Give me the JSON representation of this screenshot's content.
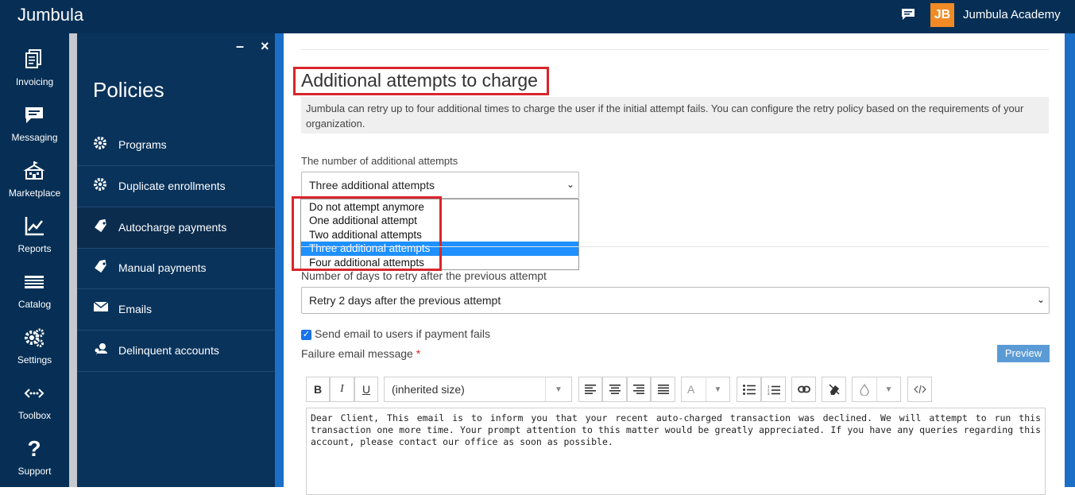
{
  "app": {
    "brand": "Jumbula",
    "org_name": "Jumbula Academy",
    "logo_text": "JB",
    "colors": {
      "nav_bg": "#072f55",
      "panel_bg": "#09335b",
      "accent": "#1b6fc6",
      "highlight": "#d9262b",
      "logo": "#f08a24"
    }
  },
  "leftnav": [
    {
      "label": "Invoicing",
      "icon": "invoice-icon"
    },
    {
      "label": "Messaging",
      "icon": "message-icon"
    },
    {
      "label": "Marketplace",
      "icon": "marketplace-icon"
    },
    {
      "label": "Reports",
      "icon": "chart-icon"
    },
    {
      "label": "Catalog",
      "icon": "catalog-icon"
    },
    {
      "label": "Settings",
      "icon": "gear-icon"
    },
    {
      "label": "Toolbox",
      "icon": "toolbox-icon"
    },
    {
      "label": "Support",
      "icon": "question-icon"
    }
  ],
  "panel": {
    "minimize": "–",
    "close": "×",
    "title": "Policies",
    "items": [
      {
        "label": "Programs",
        "icon": "gear-icon"
      },
      {
        "label": "Duplicate enrollments",
        "icon": "gear-icon"
      },
      {
        "label": "Autocharge payments",
        "icon": "tag-icon",
        "active": true
      },
      {
        "label": "Manual payments",
        "icon": "tag-icon"
      },
      {
        "label": "Emails",
        "icon": "envelope-icon"
      },
      {
        "label": "Delinquent accounts",
        "icon": "user-key-icon"
      }
    ]
  },
  "main": {
    "heading": "Additional attempts to charge",
    "info": "Jumbula can retry up to four additional times to charge the user if the initial attempt fails. You can configure the retry policy based on the requirements of your organization.",
    "attempts_label": "The number of additional attempts",
    "attempts_value": "Three additional attempts",
    "attempts_options": [
      "Do not attempt anymore",
      "One additional attempt",
      "Two additional attempts",
      "Three additional attempts",
      "Four additional attempts"
    ],
    "retry_label": "Number of days to retry after the previous attempt",
    "retry_value": "Retry 2 days after the previous attempt",
    "email_checkbox_label": "Send email to users if payment fails",
    "email_checked": true,
    "failure_label": "Failure email message",
    "required_mark": "*",
    "preview_label": "Preview",
    "editor": {
      "bold": "B",
      "italic": "I",
      "underline": "U",
      "font_size": "(inherited size)",
      "text_color": "A",
      "body": "Dear Client, This email is to inform you that your recent auto-charged transaction was declined. We will attempt to run this transaction one more time. Your prompt attention to this matter would be greatly appreciated. If you have any queries regarding this account, please contact our office as soon as possible."
    }
  }
}
